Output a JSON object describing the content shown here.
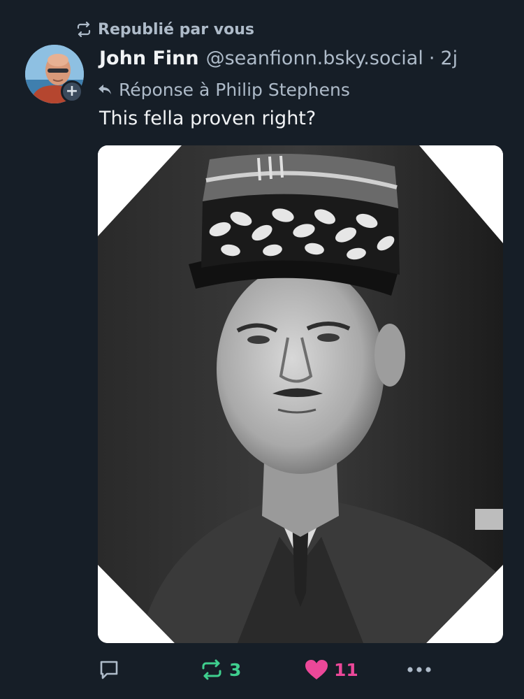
{
  "repost": {
    "label": "Republié par vous",
    "icon": "repost-icon"
  },
  "author": {
    "name": "John Finn",
    "handle": "@seanfionn.bsky.social",
    "separator": "·",
    "time": "2j",
    "follow_badge": "+"
  },
  "reply_to": {
    "label": "Réponse à Philip Stephens",
    "icon": "reply-arrow-icon"
  },
  "post": {
    "text": "This fella proven right?",
    "image": {
      "description_icon": "embedded-photo",
      "style": "black-and-white portrait of a man in a military kepi and uniform"
    }
  },
  "actions": {
    "reply_icon": "comment-icon",
    "repost_icon": "repost-icon",
    "repost_count": "3",
    "like_icon": "heart-icon",
    "like_count": "11",
    "more_icon": "more-dots-icon"
  },
  "colors": {
    "background": "#161e27",
    "muted_text": "#aebbc9",
    "repost_active": "#3fcf8e",
    "like_active": "#ec4899"
  }
}
